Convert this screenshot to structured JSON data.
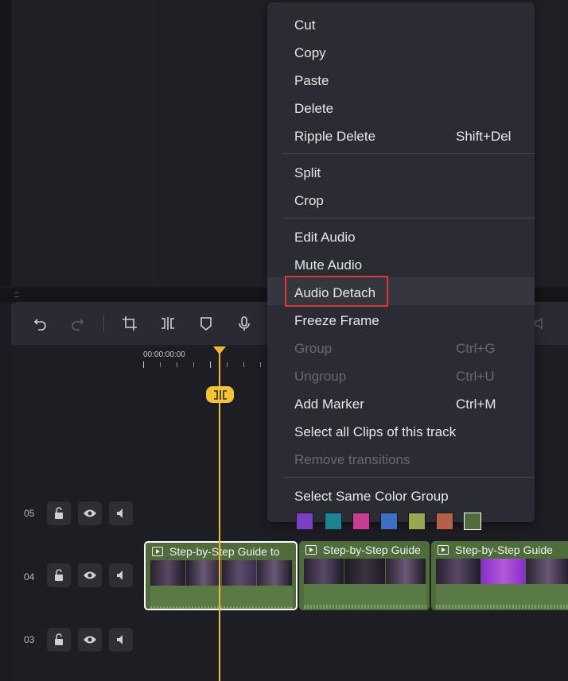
{
  "colors": {
    "accent": "#f4b730",
    "menu_bg": "#2b2b33",
    "highlight_border": "#d83a3a",
    "clip_green": "#4e6d3b"
  },
  "toolbar": {
    "icons": [
      "undo-icon",
      "redo-icon",
      "crop-icon",
      "split-icon",
      "marker-icon",
      "mic-icon"
    ]
  },
  "ruler": {
    "timecode": "00:00:00:00"
  },
  "tracks": [
    {
      "number": "05"
    },
    {
      "number": "04"
    },
    {
      "number": "03"
    }
  ],
  "clips": [
    {
      "title": "Step-by-Step Guide to",
      "selected": true
    },
    {
      "title": "Step-by-Step Guide",
      "selected": false
    },
    {
      "title": "Step-by-Step Guide",
      "selected": false
    }
  ],
  "context_menu": {
    "items": [
      {
        "label": "Cut",
        "shortcut": "",
        "enabled": true
      },
      {
        "label": "Copy",
        "shortcut": "",
        "enabled": true
      },
      {
        "label": "Paste",
        "shortcut": "",
        "enabled": true
      },
      {
        "label": "Delete",
        "shortcut": "",
        "enabled": true
      },
      {
        "label": "Ripple Delete",
        "shortcut": "Shift+Del",
        "enabled": true
      },
      {
        "label": "Split",
        "shortcut": "",
        "enabled": true
      },
      {
        "label": "Crop",
        "shortcut": "",
        "enabled": true
      },
      {
        "label": "Edit Audio",
        "shortcut": "",
        "enabled": true
      },
      {
        "label": "Mute Audio",
        "shortcut": "",
        "enabled": true
      },
      {
        "label": "Audio Detach",
        "shortcut": "",
        "enabled": true
      },
      {
        "label": "Freeze Frame",
        "shortcut": "",
        "enabled": true
      },
      {
        "label": "Group",
        "shortcut": "Ctrl+G",
        "enabled": false
      },
      {
        "label": "Ungroup",
        "shortcut": "Ctrl+U",
        "enabled": false
      },
      {
        "label": "Add Marker",
        "shortcut": "Ctrl+M",
        "enabled": true
      },
      {
        "label": "Select all Clips of this track",
        "shortcut": "",
        "enabled": true
      },
      {
        "label": "Remove transitions",
        "shortcut": "",
        "enabled": false
      },
      {
        "label": "Select Same Color Group",
        "shortcut": "",
        "enabled": true
      }
    ],
    "swatches": [
      "#7b3fc4",
      "#1c8394",
      "#c43f93",
      "#3d6fc2",
      "#9ba652",
      "#b5614a",
      "#4e6d3b"
    ]
  }
}
